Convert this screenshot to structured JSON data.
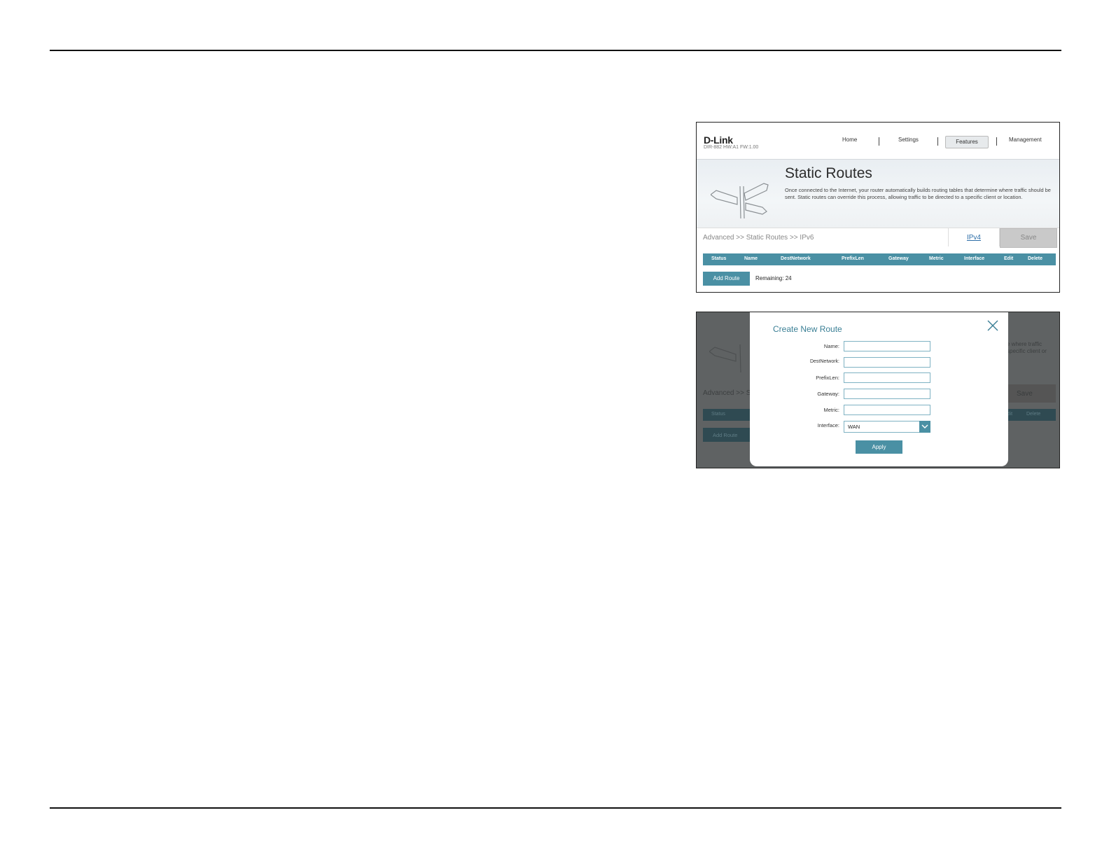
{
  "router_page": {
    "brand": "D-Link",
    "firmware": "DIR-882 HW:A1 FW:1.00",
    "nav": {
      "home": "Home",
      "settings": "Settings",
      "features": "Features",
      "management": "Management"
    },
    "title": "Static Routes",
    "description": "Once connected to the Internet, your router automatically builds routing tables that determine where traffic should be sent. Static routes can override this process, allowing traffic to be directed to a specific client or location.",
    "breadcrumb": "Advanced >> Static Routes >> IPv6",
    "ipv4_link": "IPv4",
    "save_label": "Save",
    "table_headers": [
      "Status",
      "Name",
      "DestNetwork",
      "PrefixLen",
      "Gateway",
      "Metric",
      "Interface",
      "Edit",
      "Delete"
    ],
    "add_route_label": "Add Route",
    "remaining": "Remaining: 24"
  },
  "dimmed_page": {
    "breadcrumb_fragment": "Advanced >> S",
    "save_label": "Save",
    "status_header": "Status",
    "edit_header": "Edit",
    "delete_header": "Delete",
    "add_route_label": "Add Route",
    "desc_fragment_1": "e where traffic",
    "desc_fragment_2": "specific client or"
  },
  "modal": {
    "title": "Create New Route",
    "fields": {
      "name": "Name:",
      "dest_network": "DestNetwork:",
      "prefix_len": "PrefixLen:",
      "gateway": "Gateway:",
      "metric": "Metric:",
      "interface": "Interface:"
    },
    "interface_value": "WAN",
    "apply_label": "Apply"
  },
  "colors": {
    "accent": "#4a90a4",
    "link": "#2d6ea8",
    "overlay": "#5f6263"
  }
}
